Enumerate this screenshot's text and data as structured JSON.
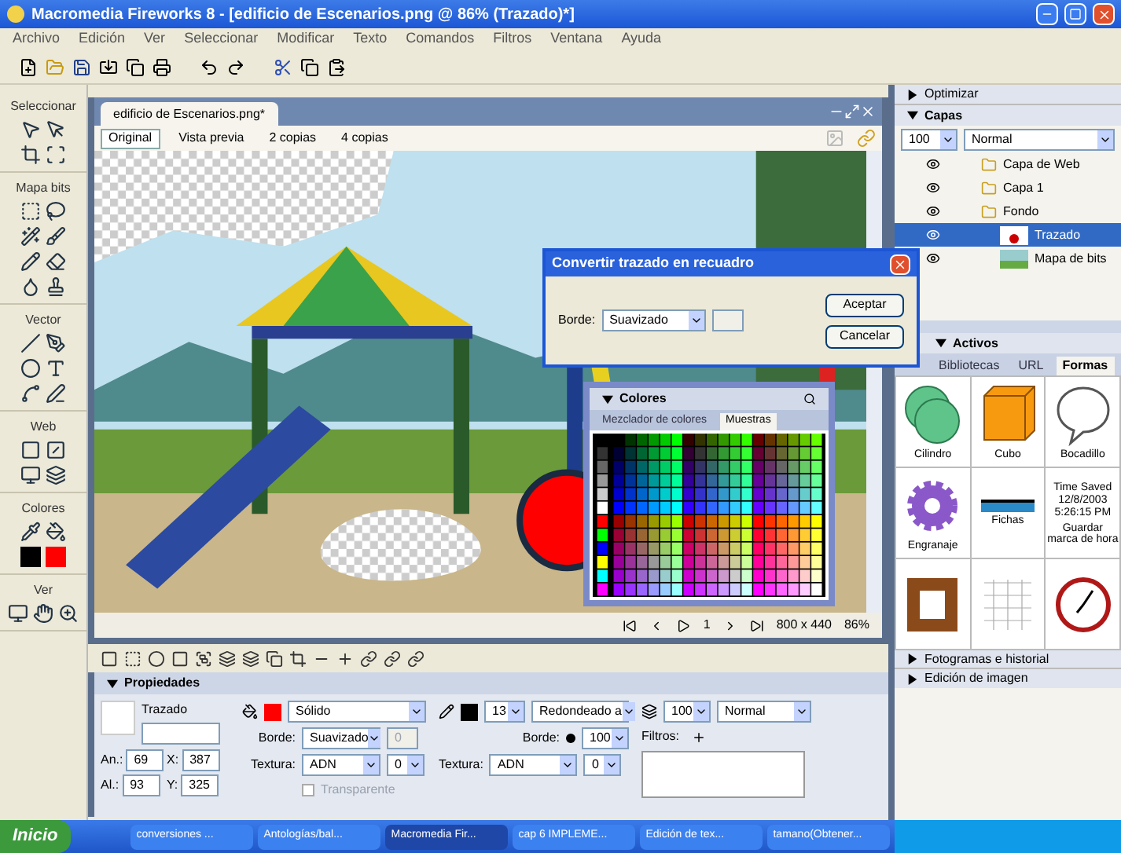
{
  "window": {
    "title": "Macromedia Fireworks 8 - [edificio de Escenarios.png @ 86% (Trazado)*]"
  },
  "menu": [
    "Archivo",
    "Edición",
    "Ver",
    "Seleccionar",
    "Modificar",
    "Texto",
    "Comandos",
    "Filtros",
    "Ventana",
    "Ayuda"
  ],
  "tools": [
    {
      "label": "Seleccionar"
    },
    {
      "label": "Mapa bits"
    },
    {
      "label": "Vector"
    },
    {
      "label": "Web"
    },
    {
      "label": "Colores"
    },
    {
      "label": "Ver"
    }
  ],
  "document": {
    "tab": "edificio de Escenarios.png*",
    "views": [
      {
        "label": "Original",
        "selected": true
      },
      {
        "label": "Vista previa",
        "selected": false
      },
      {
        "label": "2 copias",
        "selected": false
      },
      {
        "label": "4 copias",
        "selected": false
      }
    ],
    "frame": "1",
    "size": "800 x 440",
    "zoom": "86%"
  },
  "dialog": {
    "title": "Convertir trazado en recuadro",
    "edge_label": "Borde:",
    "edge": "Suavizado",
    "buttons": [
      "Aceptar",
      "Cancelar"
    ]
  },
  "colors_panel": {
    "title": "Colores",
    "expanded": true,
    "tabs": [
      {
        "label": "Mezclador de colores",
        "selected": false
      },
      {
        "label": "Muestras",
        "selected": true
      }
    ]
  },
  "right_panels": {
    "optimize": {
      "title": "Optimizar",
      "expanded": false
    },
    "layers": {
      "title": "Capas",
      "expanded": true,
      "opacity": "100",
      "blend": "Normal",
      "rows": [
        {
          "name": "Capa de Web",
          "kind": "layer",
          "selected": false
        },
        {
          "name": "Capa 1",
          "kind": "layer",
          "selected": false
        },
        {
          "name": "Fondo",
          "kind": "layer",
          "selected": false
        },
        {
          "name": "Trazado",
          "kind": "path",
          "selected": true
        },
        {
          "name": "Mapa de bits",
          "kind": "bitmap",
          "selected": false
        }
      ]
    },
    "assets": {
      "title": "Activos",
      "expanded": true,
      "tabs": [
        {
          "label": "Bibliotecas",
          "selected": false
        },
        {
          "label": "URL",
          "selected": false
        },
        {
          "label": "Formas",
          "selected": true
        }
      ],
      "shapes": [
        {
          "kind": "cylinder",
          "label": "Cilindro"
        },
        {
          "kind": "cube",
          "label": "Cubo"
        },
        {
          "kind": "bubble",
          "label": "Bocadillo"
        },
        {
          "kind": "gear",
          "label": "Engranaje"
        },
        {
          "kind": "tab",
          "label": "Fichas"
        },
        {
          "kind": "timestamp",
          "label": "Guardar marca de hora",
          "preview": "Time Saved 12/8/2003 5:26:15 PM"
        },
        {
          "kind": "frame"
        },
        {
          "kind": "grid"
        },
        {
          "kind": "clock"
        }
      ]
    },
    "frames": {
      "title": "Fotogramas e historial",
      "expanded": false
    },
    "image_edit": {
      "title": "Edición de imagen",
      "expanded": false
    }
  },
  "properties": {
    "title": "Propiedades",
    "expanded": true,
    "object": "Trazado",
    "fields": [
      {
        "label": "An.:",
        "value": "69"
      },
      {
        "label": "X:",
        "value": "387"
      },
      {
        "label": "Al.:",
        "value": "93"
      },
      {
        "label": "Y:",
        "value": "325"
      }
    ],
    "fill": {
      "color": "#ff0000",
      "type": "Sólido",
      "edge_label": "Borde:",
      "edge": "Suavizado",
      "edge_amount": "0",
      "texture_label": "Textura:",
      "texture": "ADN",
      "texture_amount": "0",
      "transparent": "Transparente",
      "transparent_checked": false
    },
    "stroke": {
      "color": "#000000",
      "size": "13",
      "type": "Redondeado a",
      "edge_label": "Borde:",
      "edge_amount": "100",
      "texture_label": "Textura:",
      "texture": "ADN",
      "texture_amount": "0"
    },
    "blend": {
      "opacity": "100",
      "mode": "Normal",
      "filters_label": "Filtros:"
    }
  },
  "taskbar": {
    "start": "Inicio",
    "items": [
      {
        "label": "conversiones ...",
        "selected": false
      },
      {
        "label": "Antologías/bal...",
        "selected": false
      },
      {
        "label": "Macromedia Fir...",
        "selected": true
      },
      {
        "label": "cap 6 IMPLEME...",
        "selected": false
      },
      {
        "label": "Edición de tex...",
        "selected": false
      },
      {
        "label": "tamano(Obtener...",
        "selected": false
      }
    ]
  }
}
